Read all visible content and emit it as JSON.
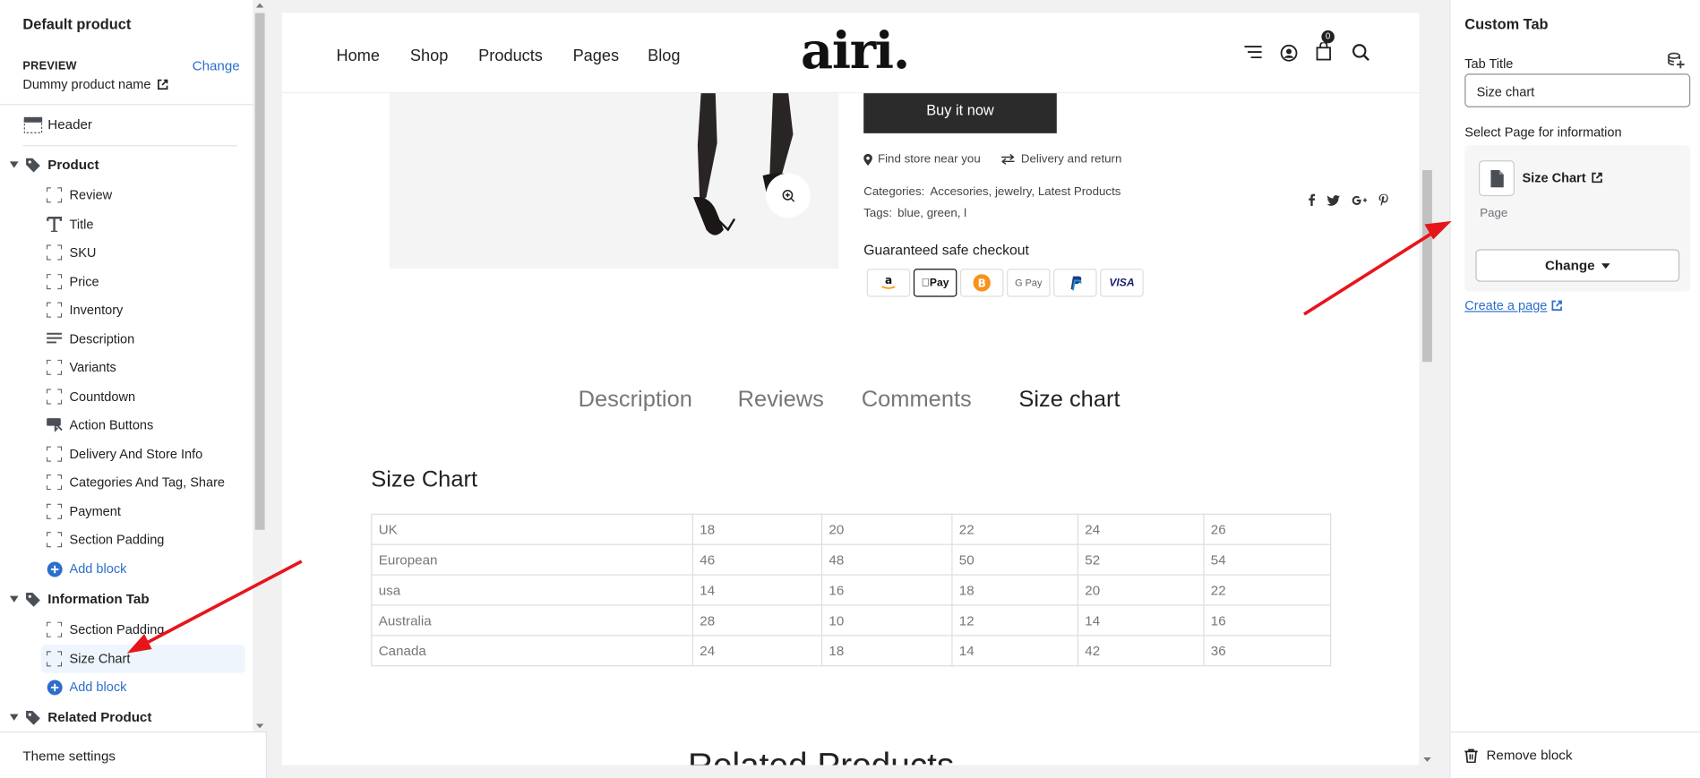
{
  "left": {
    "title": "Default product",
    "preview_label": "PREVIEW",
    "change_label": "Change",
    "product_name": "Dummy product name",
    "header_label": "Header",
    "product_section": "Product",
    "product_blocks": [
      "Review",
      "Title",
      "SKU",
      "Price",
      "Inventory",
      "Description",
      "Variants",
      "Countdown",
      "Action Buttons",
      "Delivery And Store Info",
      "Categories And Tag, Share",
      "Payment",
      "Section Padding"
    ],
    "add_block": "Add block",
    "info_section": "Information Tab",
    "info_blocks": [
      "Section Padding",
      "Size Chart"
    ],
    "related_section": "Related Product",
    "theme_settings": "Theme settings"
  },
  "store": {
    "nav": [
      "Home",
      "Shop",
      "Products",
      "Pages",
      "Blog"
    ],
    "logo": "airi.",
    "cart_count": "0",
    "buy_now": "Buy it now",
    "find_store": "Find store near you",
    "delivery": "Delivery and return",
    "categories_label": "Categories:",
    "categories": "Accesories, jewelry, Latest Products",
    "tags_label": "Tags:",
    "tags": "blue, green, l",
    "guaranteed": "Guaranteed safe checkout",
    "payments": [
      "amazon",
      "Apple Pay",
      "bitcoin",
      "G Pay",
      "PayPal",
      "VISA"
    ],
    "tabs": [
      "Description",
      "Reviews",
      "Comments",
      "Size chart"
    ],
    "active_tab": "Size chart",
    "size_chart_title": "Size Chart",
    "size_table": [
      [
        "UK",
        "18",
        "20",
        "22",
        "24",
        "26"
      ],
      [
        "European",
        "46",
        "48",
        "50",
        "52",
        "54"
      ],
      [
        "usa",
        "14",
        "16",
        "18",
        "20",
        "22"
      ],
      [
        "Australia",
        "28",
        "10",
        "12",
        "14",
        "16"
      ],
      [
        "Canada",
        "24",
        "18",
        "14",
        "42",
        "36"
      ]
    ],
    "related_title": "Related Products"
  },
  "right": {
    "title": "Custom Tab",
    "tab_title_label": "Tab Title",
    "tab_title_value": "Size chart",
    "select_page_label": "Select Page for information",
    "page_name": "Size Chart",
    "page_type": "Page",
    "change_button": "Change",
    "create_page": "Create a page",
    "remove_block": "Remove block"
  },
  "colors": {
    "link": "#2c6ecb",
    "annotation_arrow": "#e8141b"
  }
}
